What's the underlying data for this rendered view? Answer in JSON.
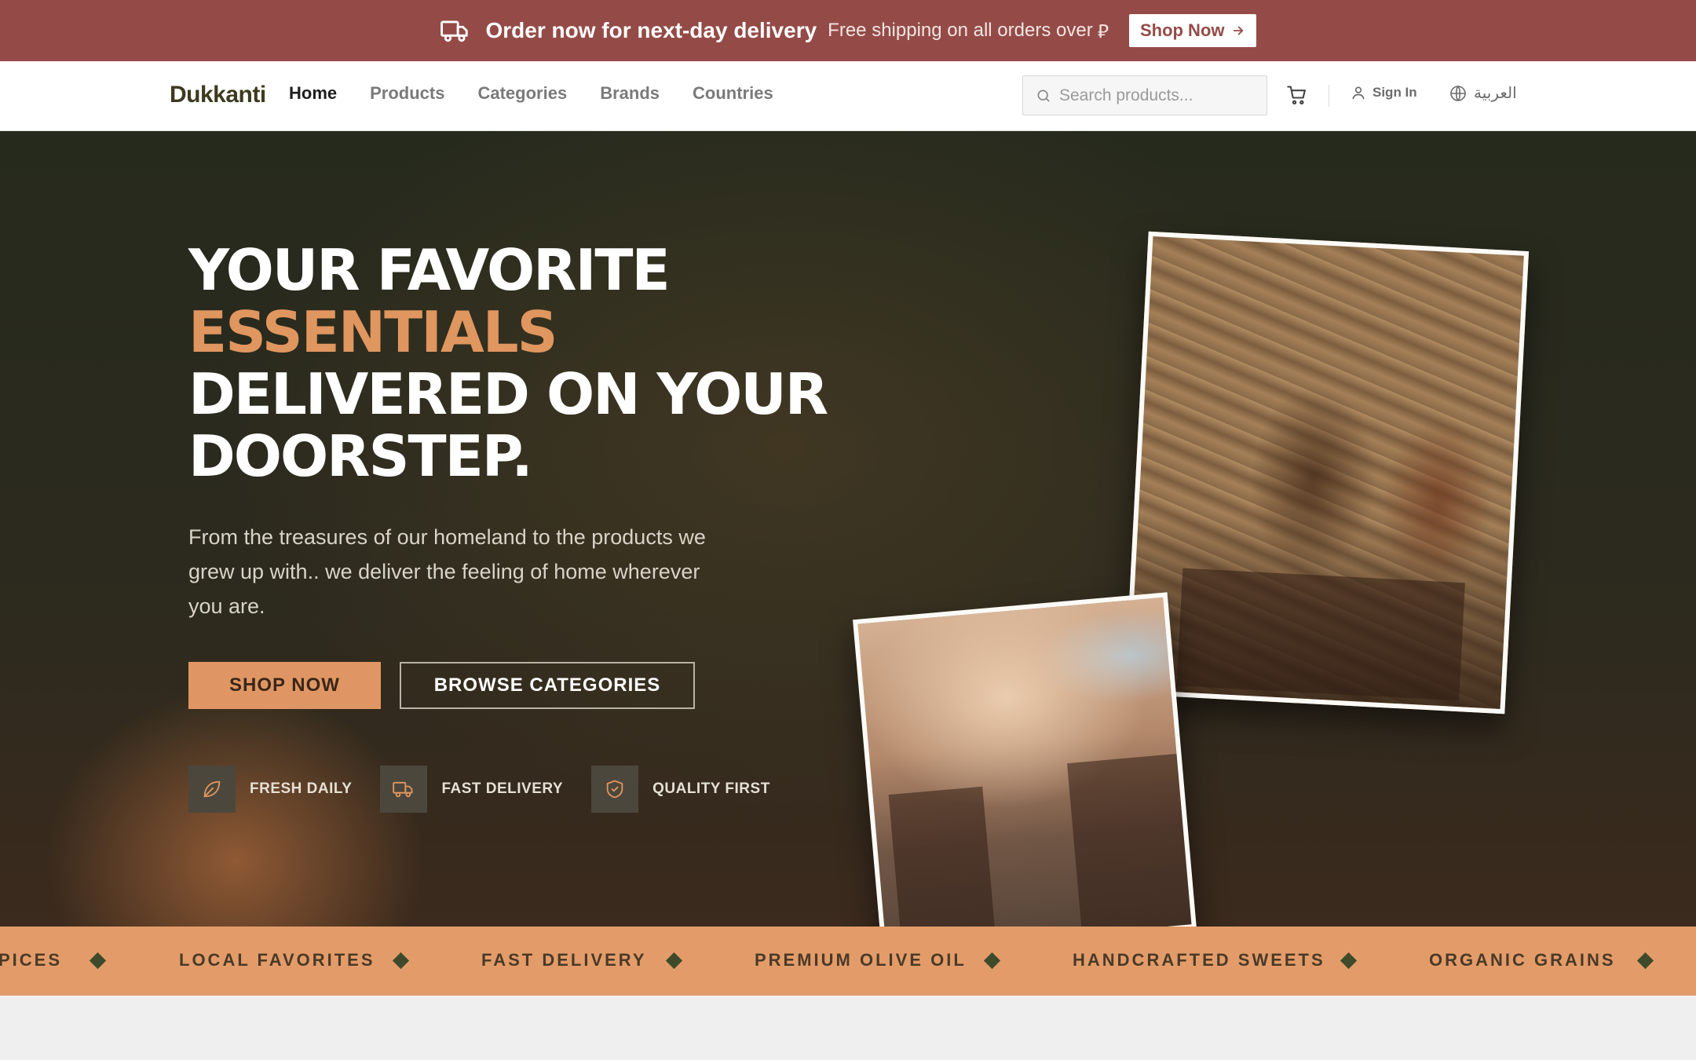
{
  "announcement": {
    "headline": "Order now for next-day delivery",
    "subtext": "Free shipping on all orders over",
    "currency_symbol": "⃃",
    "button_label": "Shop Now",
    "bg_color": "#944b47"
  },
  "nav": {
    "logo": "Dukkanti",
    "links": [
      {
        "label": "Home",
        "active": true
      },
      {
        "label": "Products",
        "active": false
      },
      {
        "label": "Categories",
        "active": false
      },
      {
        "label": "Brands",
        "active": false
      },
      {
        "label": "Countries",
        "active": false
      }
    ],
    "search_placeholder": "Search products...",
    "cart_icon": "cart-icon",
    "signin_label": "Sign In",
    "language_label": "العربية"
  },
  "hero": {
    "headline_line1": "YOUR FAVORITE",
    "headline_accent": "ESSENTIALS",
    "headline_line3": "DELIVERED ON YOUR",
    "headline_line4": "DOORSTEP.",
    "subtext": "From the treasures of our homeland to the products we grew up with.. we deliver the feeling of home wherever you are.",
    "primary_button": "SHOP NOW",
    "secondary_button": "BROWSE CATEGORIES",
    "features": [
      {
        "icon": "leaf-icon",
        "label": "FRESH DAILY"
      },
      {
        "icon": "truck-icon",
        "label": "FAST DELIVERY"
      },
      {
        "icon": "shield-check-icon",
        "label": "QUALITY FIRST"
      }
    ],
    "accent_color": "#df965f"
  },
  "marquee": {
    "items": [
      "PICES",
      "LOCAL FAVORITES",
      "FAST DELIVERY",
      "PREMIUM OLIVE OIL",
      "HANDCRAFTED SWEETS",
      "ORGANIC GRAINS"
    ],
    "bg_color": "#e39c69"
  }
}
